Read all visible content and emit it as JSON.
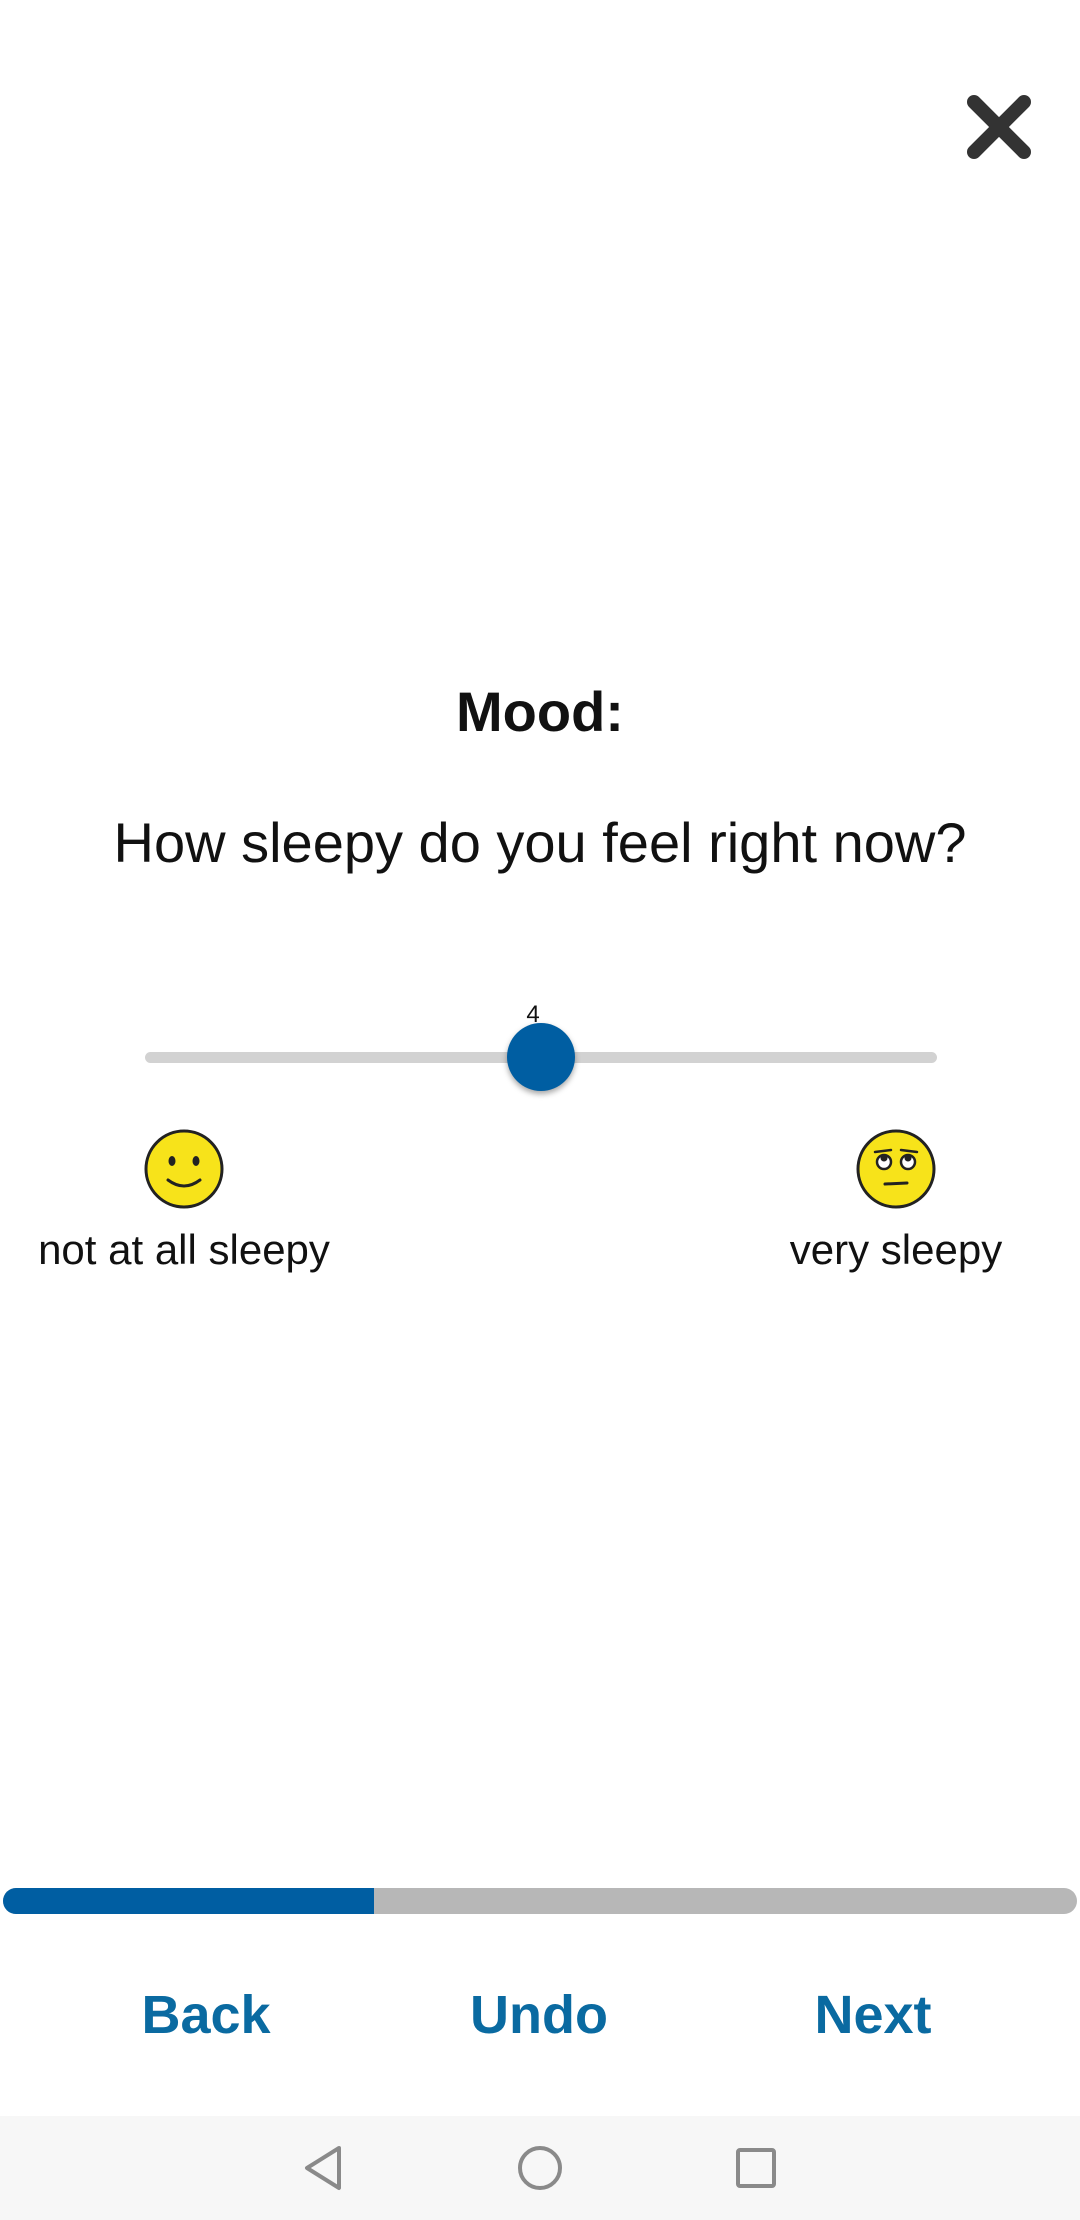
{
  "header": {
    "close_icon": "close-icon"
  },
  "survey": {
    "title": "Mood:",
    "question": "How sleepy do you feel right now?",
    "slider": {
      "min": 0,
      "max": 8,
      "value": 4,
      "value_label": "4",
      "accent_color": "#005ea2",
      "track_color": "#d2d2d2"
    },
    "anchors": {
      "left": {
        "label": "not at all sleepy",
        "icon": "slightly-smiling-face-icon"
      },
      "right": {
        "label": "very sleepy",
        "icon": "eye-roll-face-icon"
      }
    }
  },
  "progress": {
    "fraction": 0.345,
    "fill_color": "#005ea2",
    "track_color": "#b7b7b7"
  },
  "footer": {
    "back_label": "Back",
    "undo_label": "Undo",
    "next_label": "Next",
    "link_color": "#0a6aa1"
  },
  "system_nav": {
    "back_icon": "triangle-back-icon",
    "home_icon": "circle-home-icon",
    "recents_icon": "square-recents-icon"
  }
}
